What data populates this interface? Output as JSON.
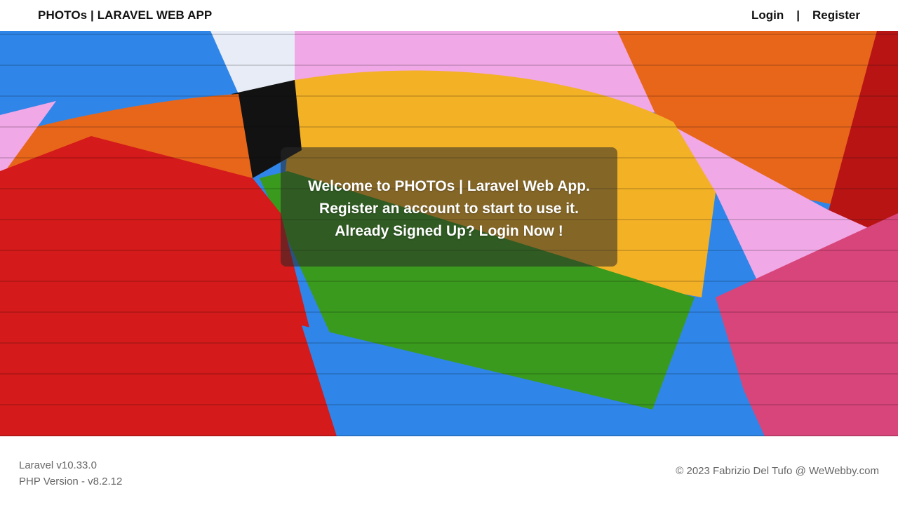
{
  "header": {
    "brand": "PHOTOs | LARAVEL WEB APP",
    "nav": {
      "login": "Login",
      "separator": "|",
      "register": "Register"
    }
  },
  "hero": {
    "background_image": "colorful-painted-brick-wall",
    "message": {
      "line1": "Welcome to PHOTOs | Laravel Web App.",
      "line2": "Register an account to start to use it.",
      "line3": "Already Signed Up? Login Now !"
    }
  },
  "footer": {
    "laravel_version": "Laravel v10.33.0",
    "php_version": "PHP Version - v8.2.12",
    "copyright": "© 2023 Fabrizio Del Tufo @ WeWebby.com"
  },
  "colors": {
    "blue": "#2f86e8",
    "red": "#d41a1a",
    "orange": "#e86a1c",
    "yellow": "#f3b126",
    "pink": "#f0a8e6",
    "green": "#3a9a1e",
    "black": "#111111",
    "overlay": "#282828"
  }
}
